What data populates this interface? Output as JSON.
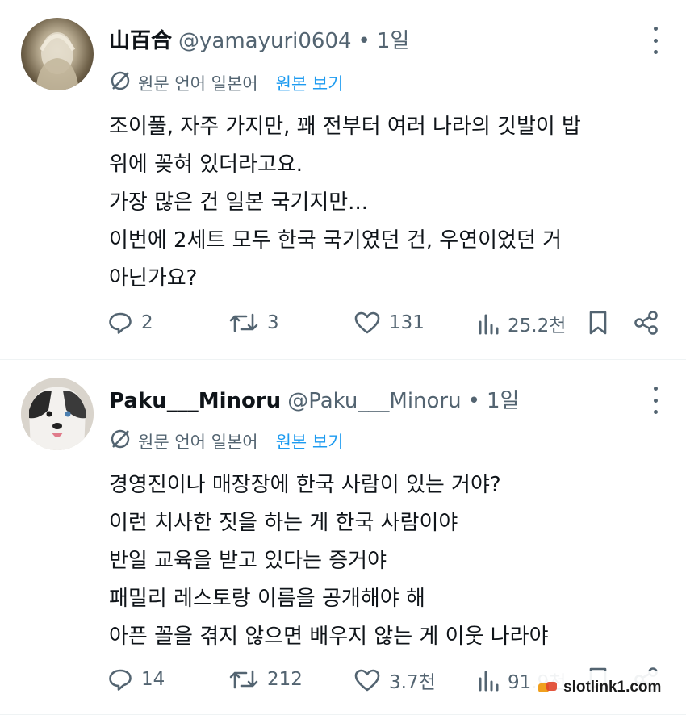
{
  "posts": [
    {
      "author": "山百合",
      "handle": "@yamayuri0604",
      "separator": "•",
      "time": "1일",
      "translate_label": "원문 언어 일본어",
      "translate_link": "원본 보기",
      "lines": [
        "조이풀, 자주 가지만, 꽤 전부터 여러 나라의 깃발이 밥",
        "위에 꽂혀 있더라고요.",
        "가장 많은 건 일본 국기지만...",
        "이번에 2세트 모두 한국 국기였던 건, 우연이었던 거",
        "아닌가요?"
      ],
      "replies": "2",
      "reposts": "3",
      "likes": "131",
      "views": "25.2천"
    },
    {
      "author": "Paku___Minoru",
      "handle": "@Paku___Minoru",
      "separator": "•",
      "time": "1일",
      "translate_label": "원문 언어 일본어",
      "translate_link": "원본 보기",
      "lines": [
        "경영진이나 매장장에 한국 사람이 있는 거야?",
        "이런 치사한 짓을 하는 게 한국 사람이야",
        "반일 교육을 받고 있다는 증거야",
        "패밀리 레스토랑 이름을 공개해야 해",
        "아픈 꼴을 겪지 않으면 배우지 않는 게 이웃 나라야"
      ],
      "replies": "14",
      "reposts": "212",
      "likes": "3.7천",
      "views": "91.9천"
    }
  ],
  "watermark": "slotlink1.com",
  "colors": {
    "text": "#0f1419",
    "muted": "#536471",
    "link": "#1d9bf0",
    "divider": "#eff3f4"
  }
}
